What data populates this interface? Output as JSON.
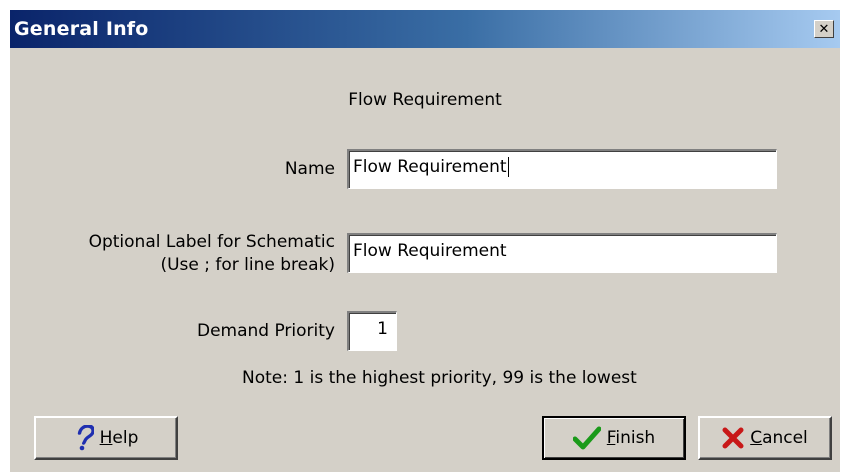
{
  "window": {
    "title": "General Info",
    "close_glyph": "✕"
  },
  "form": {
    "heading": "Flow Requirement",
    "name_label": "Name",
    "name_value": "Flow Requirement",
    "schematic_label_line1": "Optional Label for Schematic",
    "schematic_label_line2": "(Use ; for line break)",
    "schematic_value": "Flow Requirement",
    "priority_label": "Demand Priority",
    "priority_value": "1",
    "note": "Note: 1 is the highest priority, 99 is the lowest"
  },
  "buttons": {
    "help": {
      "mnemonic": "H",
      "rest": "elp",
      "icon": "question-mark-icon"
    },
    "finish": {
      "mnemonic": "F",
      "rest": "inish",
      "icon": "check-mark-icon"
    },
    "cancel": {
      "mnemonic": "C",
      "rest": "ancel",
      "icon": "x-mark-icon"
    }
  },
  "colors": {
    "titlebar_start": "#0a246a",
    "titlebar_end": "#a6caf0",
    "dialog_bg": "#d4d0c8",
    "help_icon": "#1f2fb0",
    "finish_icon": "#1a9a1a",
    "cancel_icon": "#c81818"
  }
}
